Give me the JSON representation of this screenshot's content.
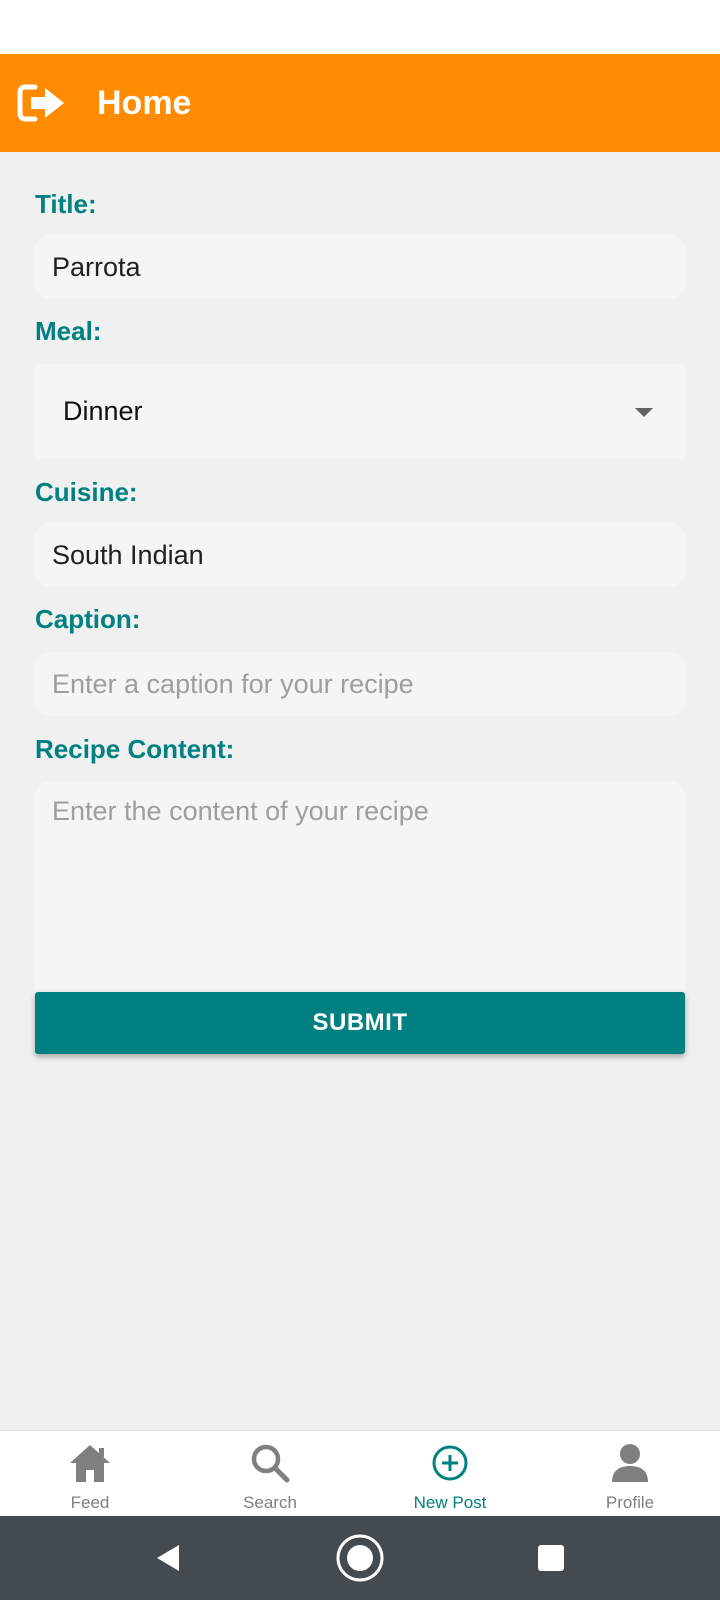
{
  "app_bar": {
    "title": "Home",
    "logout_icon": "logout-icon"
  },
  "form": {
    "title_label": "Title:",
    "title_value": "Parrota",
    "meal_label": "Meal:",
    "meal_value": "Dinner",
    "cuisine_label": "Cuisine:",
    "cuisine_value": "South Indian",
    "caption_label": "Caption:",
    "caption_placeholder": "Enter a caption for your recipe",
    "content_label": "Recipe Content:",
    "content_placeholder": "Enter the content of your recipe",
    "submit_label": "SUBMIT"
  },
  "bottom_nav": {
    "items": [
      {
        "label": "Feed",
        "icon": "home-icon"
      },
      {
        "label": "Search",
        "icon": "search-icon"
      },
      {
        "label": "New Post",
        "icon": "add-circle-icon",
        "active": true
      },
      {
        "label": "Profile",
        "icon": "person-icon"
      }
    ]
  },
  "colors": {
    "app_bar": "#FF8C00",
    "accent": "#008080",
    "background": "#F0F0F0"
  }
}
